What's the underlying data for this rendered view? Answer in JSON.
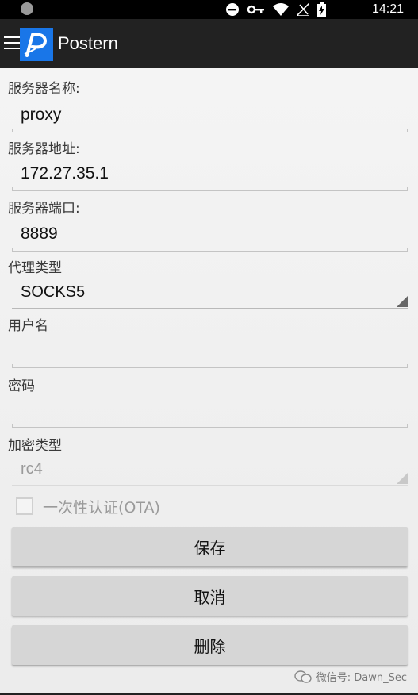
{
  "status_bar": {
    "time": "14:21"
  },
  "app_bar": {
    "title": "Postern",
    "logo_letter": "P",
    "logo_color": "#1976e8"
  },
  "form": {
    "server_name": {
      "label": "服务器名称:",
      "value": "proxy"
    },
    "server_address": {
      "label": "服务器地址:",
      "value": "172.27.35.1"
    },
    "server_port": {
      "label": "服务器端口:",
      "value": "8889"
    },
    "proxy_type": {
      "label": "代理类型",
      "value": "SOCKS5"
    },
    "username": {
      "label": "用户名",
      "value": ""
    },
    "password": {
      "label": "密码",
      "value": ""
    },
    "encryption_type": {
      "label": "加密类型",
      "value": "rc4"
    },
    "ota": {
      "label": "一次性认证(OTA)",
      "checked": false
    }
  },
  "buttons": {
    "save": "保存",
    "cancel": "取消",
    "delete": "删除"
  },
  "watermark": {
    "text": "微信号: Dawn_Sec"
  }
}
